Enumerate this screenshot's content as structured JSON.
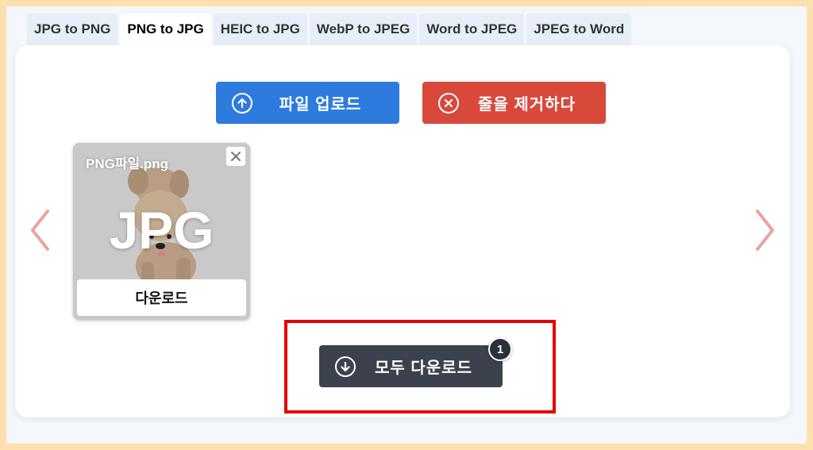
{
  "tabs": [
    {
      "label": "JPG to PNG"
    },
    {
      "label": "PNG to JPG"
    },
    {
      "label": "HEIC to JPG"
    },
    {
      "label": "WebP to JPEG"
    },
    {
      "label": "Word to JPEG"
    },
    {
      "label": "JPEG to Word"
    }
  ],
  "active_tab": "PNG to JPG",
  "toolbar": {
    "upload_label": "파일 업로드",
    "clear_label": "줄을 제거하다"
  },
  "file_card": {
    "filename": "PNG파일.png",
    "format_overlay": "JPG",
    "download_label": "다운로드"
  },
  "download_all": {
    "label": "모두 다운로드",
    "count": "1"
  },
  "icons": {
    "upload": "arrow-up-circle-icon",
    "clear": "x-circle-icon",
    "close": "close-icon",
    "prev": "chevron-left-icon",
    "next": "chevron-right-icon",
    "download": "arrow-down-circle-icon"
  },
  "colors": {
    "upload": "#2e7bdf",
    "clear": "#d8493c",
    "download_all": "#3b424d",
    "highlight": "#e60000",
    "arrows": "#e8a59c",
    "frame": "#fde0ad"
  }
}
